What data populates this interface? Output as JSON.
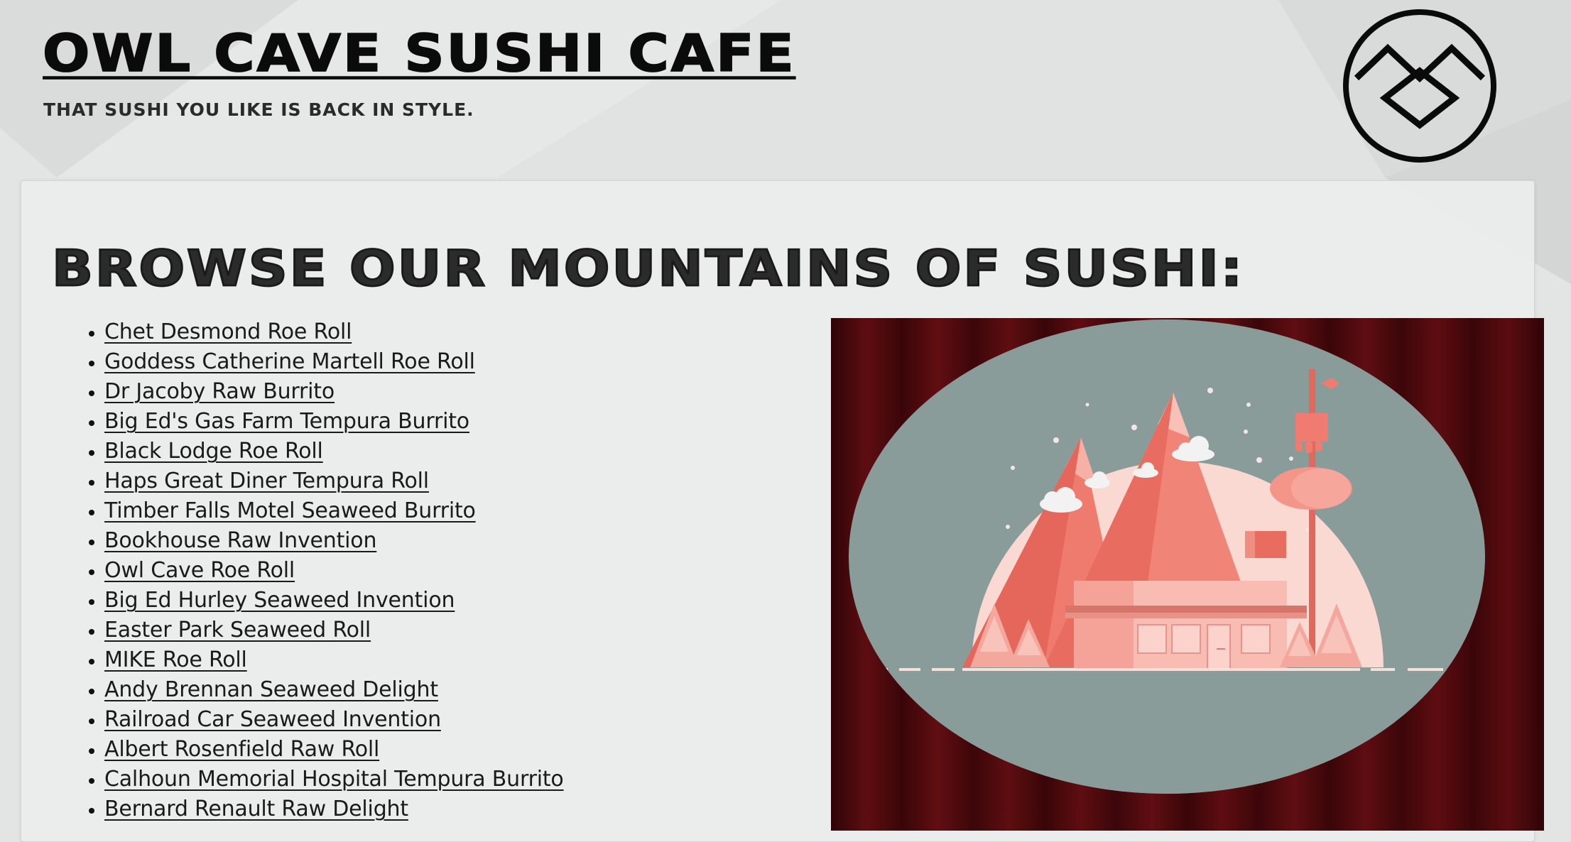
{
  "header": {
    "site_title": "Owl Cave Sushi Cafe",
    "tagline": "That sushi you like is back in style.",
    "logo_icon": "owl-cave-symbol-icon"
  },
  "main": {
    "heading": "Browse our mountains of sushi:",
    "menu_items": [
      "Chet Desmond Roe Roll",
      "Goddess Catherine Martell Roe Roll",
      "Dr Jacoby Raw Burrito",
      "Big Ed's Gas Farm Tempura Burrito",
      "Black Lodge Roe Roll",
      "Haps Great Diner Tempura Roll",
      "Timber Falls Motel Seaweed Burrito",
      "Bookhouse Raw Invention",
      "Owl Cave Roe Roll",
      "Big Ed Hurley Seaweed Invention",
      "Easter Park Seaweed Roll",
      "MIKE Roe Roll",
      "Andy Brennan Seaweed Delight",
      "Railroad Car Seaweed Invention",
      "Albert Rosenfield Raw Roll",
      "Calhoun Memorial Hospital Tempura Burrito",
      "Bernard Renault Raw Delight"
    ],
    "hero_image": {
      "icon": "diner-mountains-illustration-icon",
      "colors": {
        "curtain": "#5a0d10",
        "oval": "#8a9c9a",
        "mountain": "#ef7b6e",
        "sun": "#fbd9d3"
      }
    }
  },
  "colors": {
    "background": "#e3e4e4",
    "panel": "#ecedee",
    "text": "#111111"
  }
}
